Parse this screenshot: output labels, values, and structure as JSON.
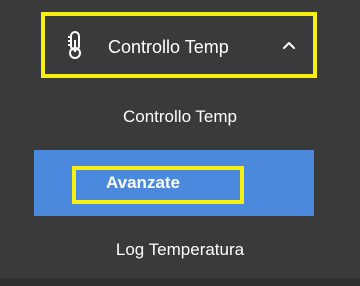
{
  "menu": {
    "header": {
      "icon": "thermometer-icon",
      "label": "Controllo Temp",
      "chevron": "chevron-up-icon"
    },
    "items": [
      {
        "label": "Controllo Temp",
        "active": false
      },
      {
        "label": "Avanzate",
        "active": true
      },
      {
        "label": "Log Temperatura",
        "active": false
      }
    ]
  },
  "colors": {
    "background": "#3a3a3a",
    "active_background": "#4a89dc",
    "highlight_border": "#f7ef12",
    "text": "#ffffff"
  }
}
